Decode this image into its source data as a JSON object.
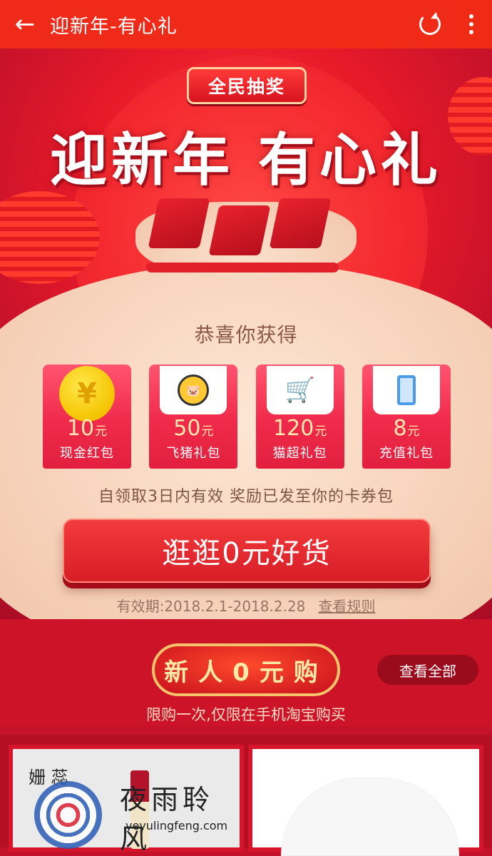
{
  "topbar": {
    "title": "迎新年-有心礼",
    "back_icon": "arrow-left-icon",
    "refresh_icon": "refresh-icon",
    "more_icon": "more-vertical-icon"
  },
  "banner": {
    "badge": "全民抽奖",
    "headline": "迎新年 有心礼",
    "congrats": "恭喜你获得",
    "prizes": [
      {
        "amount": "10",
        "unit": "元",
        "name": "现金红包",
        "icon": "coin-icon"
      },
      {
        "amount": "50",
        "unit": "元",
        "name": "飞猪礼包",
        "icon": "fliggy-icon"
      },
      {
        "amount": "120",
        "unit": "元",
        "name": "猫超礼包",
        "icon": "cart-icon"
      },
      {
        "amount": "8",
        "unit": "元",
        "name": "充值礼包",
        "icon": "phone-icon"
      }
    ],
    "note": "自领取3日内有效 奖励已发至你的卡券包",
    "cta": "逛逛0元好货",
    "validity": "有效期:2018.2.1-2018.2.28",
    "rules_link": "查看规则"
  },
  "newcomer": {
    "title": "新人0元购",
    "view_all": "查看全部",
    "limit": "限购一次,仅限在手机淘宝购买"
  },
  "products": {
    "brand": "姗 蕊",
    "watermark": "夜雨聆风",
    "watermark_url": "yeyulingfeng.com"
  },
  "colors": {
    "primary_red": "#f02a1a",
    "bag_cream": "#f8d4bd",
    "gold": "#f6c36a"
  }
}
